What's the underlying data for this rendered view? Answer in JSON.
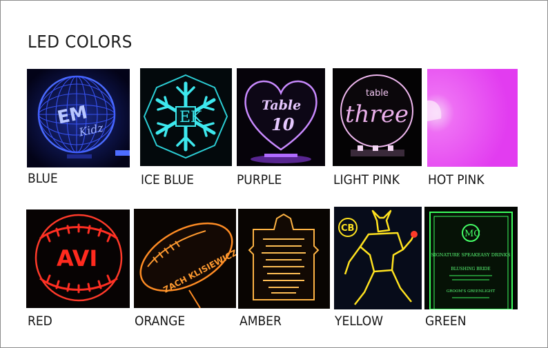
{
  "heading": "LED COLORS",
  "swatches": [
    {
      "label": "BLUE",
      "color": "#3a4cff",
      "sign_text": [
        "EM",
        "Kidz"
      ],
      "icon": "disco-ball-icon"
    },
    {
      "label": "ICE BLUE",
      "color": "#37e0e6",
      "sign_text": [],
      "icon": "snowflake-icon"
    },
    {
      "label": "PURPLE",
      "color": "#b86bff",
      "sign_text": [
        "Table",
        "10"
      ],
      "icon": "heart-sign-icon"
    },
    {
      "label": "LIGHT PINK",
      "color": "#e9a6e9",
      "sign_text": [
        "table",
        "three"
      ],
      "icon": "circle-sign-icon"
    },
    {
      "label": "HOT PINK",
      "color": "#e33df0",
      "sign_text": [],
      "icon": "color-glow-icon"
    },
    {
      "label": "RED",
      "color": "#ff2b23",
      "sign_text": [
        "AVI"
      ],
      "icon": "baseball-icon"
    },
    {
      "label": "ORANGE",
      "color": "#ff8a1e",
      "sign_text": [
        "ZACH KLISIEWICZ"
      ],
      "icon": "football-icon"
    },
    {
      "label": "AMBER",
      "color": "#ffb13a",
      "sign_text": [],
      "icon": "menu-sign-icon"
    },
    {
      "label": "YELLOW",
      "color": "#ffe21f",
      "sign_text": [
        "CB"
      ],
      "icon": "superhero-icon"
    },
    {
      "label": "GREEN",
      "color": "#36ff5a",
      "sign_text": [
        "SIGNATURE SPEAKEASY DRINKS",
        "BLUSHING BRIDE",
        "GROOM'S GREENLIGHT"
      ],
      "icon": "drink-menu-icon"
    }
  ]
}
